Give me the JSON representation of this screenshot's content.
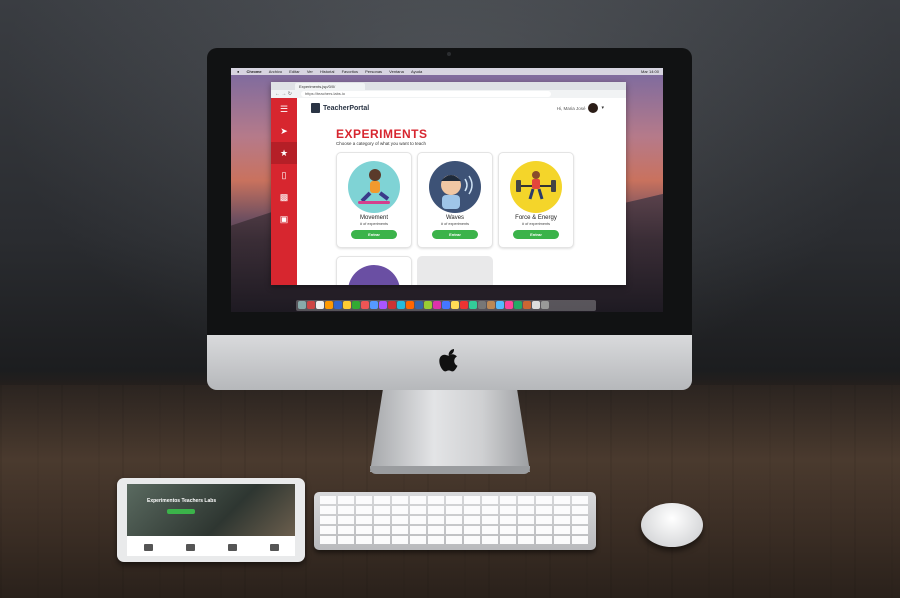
{
  "menubar": {
    "items": [
      "Chrome",
      "Archivo",
      "Editar",
      "Ver",
      "Historial",
      "Favoritos",
      "Personas",
      "Ventana",
      "Ayuda"
    ],
    "right": "Mar 14:00"
  },
  "browser": {
    "tab_title": "Experiments.jsp/0/0/",
    "url": "https://teachers.labs.io"
  },
  "portal": {
    "brand": "TeacherPortal",
    "greeting": "Hi, Maria José",
    "title": "EXPERIMENTS",
    "subtitle": "Choose a category of what you want to teach",
    "sidebar_icons": [
      "menu-icon",
      "rocket-icon",
      "trophy-icon",
      "phone-icon",
      "chart-icon",
      "monitor-icon"
    ],
    "cards": [
      {
        "name": "Movement",
        "count": "# of experiments",
        "button": "Entrar",
        "color": "#7fd3d5"
      },
      {
        "name": "Waves",
        "count": "# of experiments",
        "button": "Entrar",
        "color": "#3d5276"
      },
      {
        "name": "Force & Energy",
        "count": "# of experiments",
        "button": "Entrar",
        "color": "#f4d52a"
      }
    ]
  },
  "ipad": {
    "hero_text": "Experimentos Teachers Labs"
  },
  "colors": {
    "accent": "#d7262f",
    "button": "#3bb34a"
  }
}
